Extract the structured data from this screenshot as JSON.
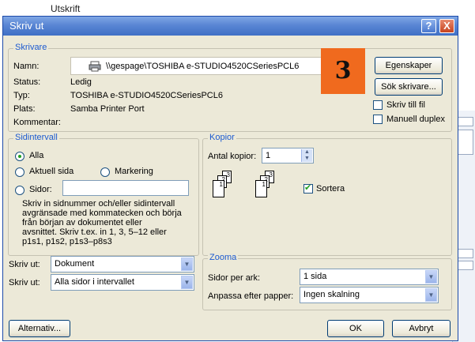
{
  "background": {
    "doc_title": "Utskrift"
  },
  "dialog": {
    "title": "Skriv ut",
    "help_glyph": "?",
    "close_glyph": "X",
    "printer": {
      "section_title": "Skrivare",
      "name_label": "Namn:",
      "name_value": "\\\\gespage\\TOSHIBA e-STUDIO4520CSeriesPCL6",
      "status_label": "Status:",
      "status_value": "Ledig",
      "type_label": "Typ:",
      "type_value": "TOSHIBA e-STUDIO4520CSeriesPCL6",
      "where_label": "Plats:",
      "where_value": "Samba Printer Port",
      "comment_label": "Kommentar:",
      "comment_value": "",
      "properties_button": "Egenskaper",
      "find_printer_button": "Sök skrivare...",
      "print_to_file_label": "Skriv till fil",
      "print_to_file_checked": false,
      "manual_duplex_label": "Manuell duplex",
      "manual_duplex_checked": false
    },
    "annotation_badge": "3",
    "page_range": {
      "section_title": "Sidintervall",
      "all_label": "Alla",
      "current_label": "Aktuell sida",
      "selection_label": "Markering",
      "pages_label": "Sidor:",
      "pages_value": "",
      "selected": "all",
      "hint_lines": [
        "Skriv in sidnummer och/eller sidintervall",
        "avgränsade med kommatecken och börja",
        "från början av dokumentet eller",
        "avsnittet. Skriv t.ex. in 1, 3, 5–12 eller",
        "p1s1, p1s2, p1s3–p8s3"
      ]
    },
    "copies": {
      "section_title": "Kopior",
      "count_label": "Antal kopior:",
      "count_value": "1",
      "collate_label": "Sortera",
      "collate_checked": true,
      "page_numbers": [
        "1",
        "2",
        "3"
      ]
    },
    "print_what": {
      "label": "Skriv ut:",
      "value": "Dokument"
    },
    "print_pages": {
      "label": "Skriv ut:",
      "value": "Alla sidor i intervallet"
    },
    "zoom": {
      "section_title": "Zooma",
      "pages_per_sheet_label": "Sidor per ark:",
      "pages_per_sheet_value": "1 sida",
      "scale_label": "Anpassa efter papper:",
      "scale_value": "Ingen skalning"
    },
    "options_button": "Alternativ...",
    "ok_button": "OK",
    "cancel_button": "Avbryt"
  },
  "colors": {
    "title_bar": "#4a78cf",
    "dialog_bg": "#ece9d8",
    "section_title": "#1c5ad0",
    "badge": "#f06a1e",
    "check_mark": "#21a121"
  }
}
